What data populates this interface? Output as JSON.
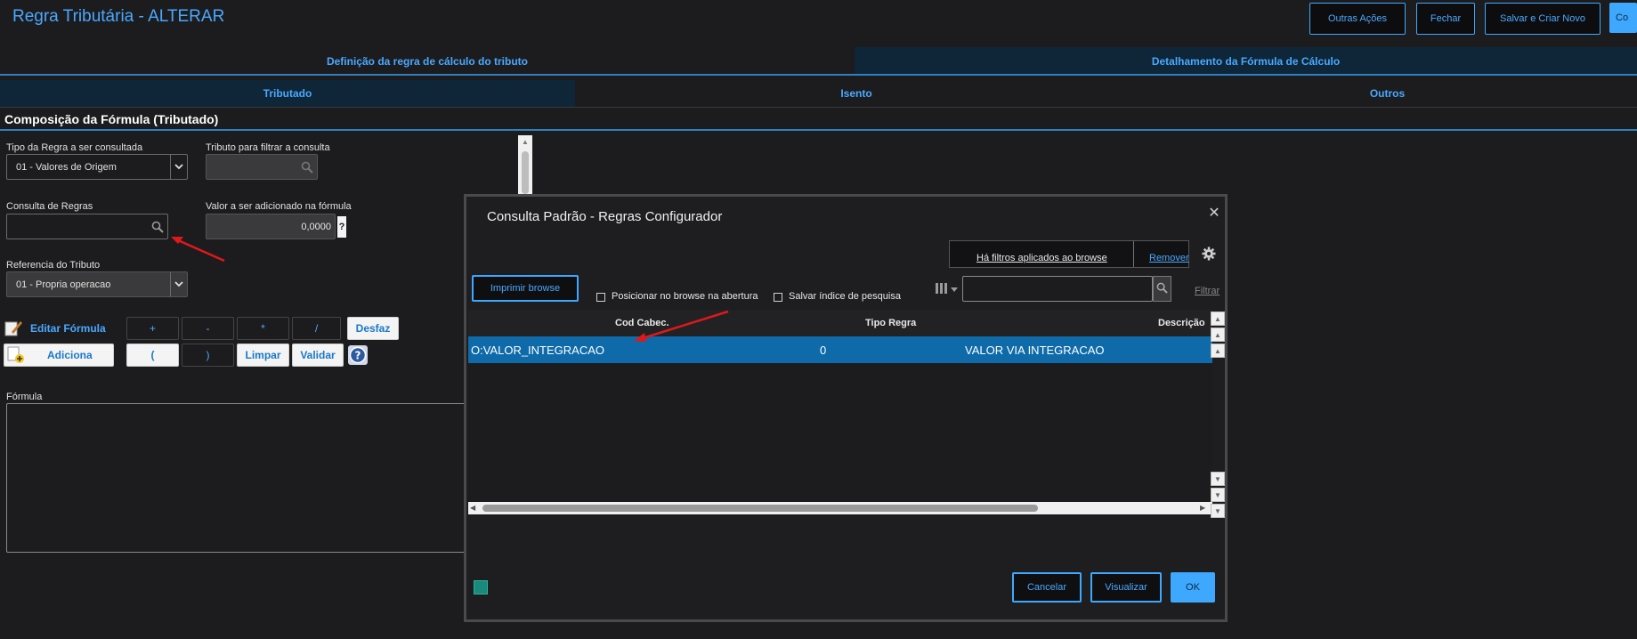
{
  "header": {
    "title": "Regra Tributária - ALTERAR",
    "buttons": {
      "outras_acoes": "Outras Ações",
      "fechar": "Fechar",
      "salvar_criar_novo": "Salvar e Criar Novo",
      "confirmar_partial": "Co"
    }
  },
  "tabs_main": [
    {
      "label": "Definição da regra de cálculo do tributo",
      "active": false
    },
    {
      "label": "Detalhamento da Fórmula de Cálculo",
      "active": true
    }
  ],
  "tabs_sub": [
    {
      "label": "Tributado",
      "active": true
    },
    {
      "label": "Isento",
      "active": false
    },
    {
      "label": "Outros",
      "active": false
    }
  ],
  "form": {
    "section_title": "Composição da Fórmula (Tributado)",
    "tipo_regra": {
      "label": "Tipo da Regra a ser consultada",
      "value": "01 - Valores de Origem"
    },
    "tributo_filtro": {
      "label": "Tributo para filtrar a consulta",
      "value": ""
    },
    "consulta_regras": {
      "label": "Consulta de Regras",
      "value": ""
    },
    "valor_adicionado": {
      "label": "Valor a ser adicionado na fórmula",
      "value": "0,0000",
      "help": "?"
    },
    "referencia_tributo": {
      "label": "Referencia do Tributo",
      "value": "01 - Propria operacao"
    },
    "editar_formula": "Editar Fórmula",
    "adiciona": "Adiciona",
    "operators": [
      "+",
      "-",
      "*",
      "/"
    ],
    "parens": [
      "(",
      ")"
    ],
    "desfaz": "Desfaz",
    "limpar": "Limpar",
    "validar": "Validar",
    "formula_label": "Fórmula",
    "formula_value": ""
  },
  "modal": {
    "title": "Consulta Padrão - Regras Configurador",
    "filters_notice": "Há filtros aplicados ao browse",
    "remover": "Remover",
    "imprimir_browse": "Imprimir browse",
    "posicionar_label": "Posicionar no browse na abertura",
    "salvar_indice_label": "Salvar índice de pesquisa",
    "search_value": "",
    "filtrar": "Filtrar",
    "columns": [
      "Cod Cabec.",
      "Tipo Regra",
      "Descrição"
    ],
    "rows": [
      {
        "cod": "O:VALOR_INTEGRACAO",
        "tipo": "0",
        "descricao": "VALOR VIA INTEGRACAO",
        "selected": true
      }
    ],
    "buttons": {
      "cancelar": "Cancelar",
      "visualizar": "Visualizar",
      "ok": "OK"
    }
  },
  "colors": {
    "background": "#1c1c1e",
    "accent": "#3ea8ff",
    "selected_row": "#0e6aa8",
    "annotation_arrow": "#e0181a"
  }
}
